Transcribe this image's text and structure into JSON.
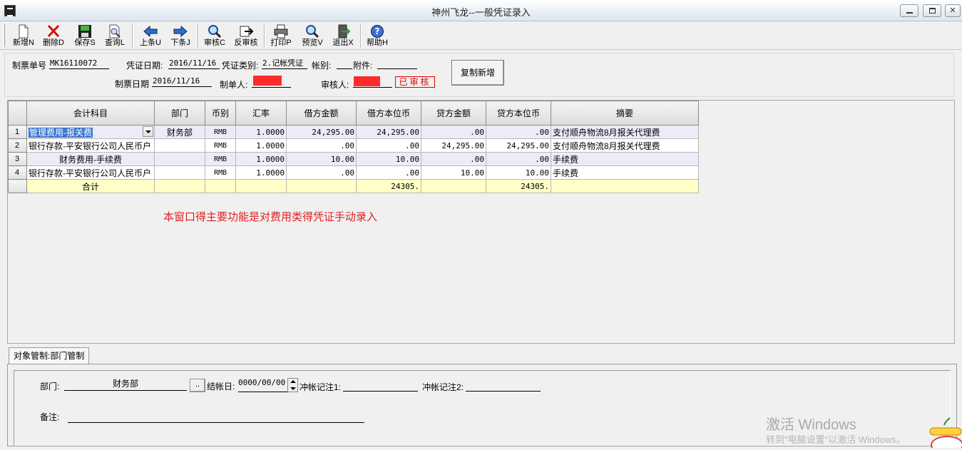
{
  "window": {
    "title": "神州飞龙--一般凭证录入"
  },
  "toolbar": {
    "items": [
      {
        "label": "新增N",
        "icon": "new-file-icon"
      },
      {
        "label": "删除D",
        "icon": "delete-x-icon"
      },
      {
        "label": "保存S",
        "icon": "floppy-disk-icon"
      },
      {
        "label": "查询L",
        "icon": "query-magnifier-icon"
      },
      {
        "label": "上条U",
        "icon": "arrow-left-icon"
      },
      {
        "label": "下条J",
        "icon": "arrow-right-icon"
      },
      {
        "label": "审核C",
        "icon": "magnifier-icon"
      },
      {
        "label": "反审核",
        "icon": "unapprove-icon"
      },
      {
        "label": "打印P",
        "icon": "printer-icon"
      },
      {
        "label": "预览V",
        "icon": "preview-magnifier-icon"
      },
      {
        "label": "退出X",
        "icon": "exit-door-icon"
      },
      {
        "label": "帮助H",
        "icon": "help-question-icon"
      }
    ]
  },
  "header": {
    "ticket_no_label": "制票单号",
    "ticket_no": "MK16110072",
    "voucher_date_label": "凭证日期:",
    "voucher_date": "2016/11/16",
    "voucher_type_label": "凭证类别:",
    "voucher_type": "2.记帐凭证",
    "account_type_label": "帐别:",
    "account_type": "",
    "attachment_label": "附件:",
    "attachment": "",
    "created_date_label": "制票日期",
    "created_date": "2016/11/16",
    "maker_label": "制单人:",
    "reviewer_label": "审核人:",
    "status_stamp": "已审核",
    "copy_new_button": "复制新增"
  },
  "grid": {
    "columns": [
      "会计科目",
      "部门",
      "币别",
      "汇率",
      "借方金额",
      "借方本位币",
      "贷方金额",
      "贷方本位币",
      "摘要"
    ],
    "rows": [
      {
        "no": "1",
        "account": "管理费用-报关费",
        "dept": "财务部",
        "currency": "RMB",
        "rate": "1.0000",
        "debit": "24,295.00",
        "debit_base": "24,295.00",
        "credit": ".00",
        "credit_base": ".00",
        "memo": "支付顺舟物流8月报关代理费"
      },
      {
        "no": "2",
        "account": "银行存款-平安银行公司人民币户",
        "dept": "",
        "currency": "RMB",
        "rate": "1.0000",
        "debit": ".00",
        "debit_base": ".00",
        "credit": "24,295.00",
        "credit_base": "24,295.00",
        "memo": "支付顺舟物流8月报关代理费"
      },
      {
        "no": "3",
        "account": "财务费用-手续费",
        "dept": "",
        "currency": "RMB",
        "rate": "1.0000",
        "debit": "10.00",
        "debit_base": "10.00",
        "credit": ".00",
        "credit_base": ".00",
        "memo": "手续费"
      },
      {
        "no": "4",
        "account": "银行存款-平安银行公司人民币户",
        "dept": "",
        "currency": "RMB",
        "rate": "1.0000",
        "debit": ".00",
        "debit_base": ".00",
        "credit": "10.00",
        "credit_base": "10.00",
        "memo": "手续费"
      }
    ],
    "total": {
      "label": "合计",
      "debit_base": "24305.",
      "credit_base": "24305."
    },
    "note": "本窗口得主要功能是对费用类得凭证手动录入"
  },
  "bottom": {
    "tab_label": "对象管制:部门管制",
    "dept_label": "部门:",
    "dept_value": "财务部",
    "browse_button": "..",
    "close_date_label": "结帐日:",
    "close_date": "0000/00/00",
    "offset_note1_label": "冲帐记注1:",
    "offset_note2_label": "冲帐记注2:",
    "remark_label": "备注:"
  },
  "watermark": {
    "line1": "激活 Windows",
    "line2": "转到\"电脑设置\"以激活 Windows。"
  },
  "colors": {
    "note": "#e02020",
    "selection": "#3a76d4",
    "total_row": "#ffffc6",
    "odd_row": "#ebebfa",
    "redaction": "#ff2a2a"
  }
}
